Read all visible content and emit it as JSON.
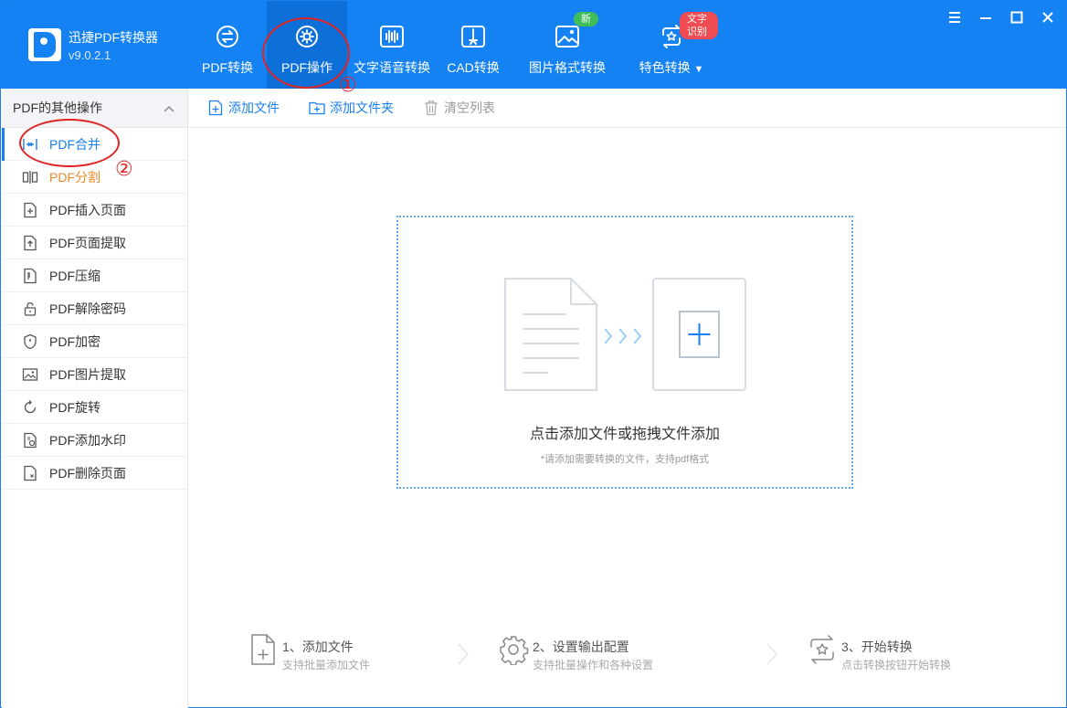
{
  "app": {
    "name": "迅捷PDF转换器",
    "version": "v9.0.2.1"
  },
  "nav": [
    {
      "label": "PDF转换",
      "icon": "pdf-convert-icon",
      "active": false
    },
    {
      "label": "PDF操作",
      "icon": "gear-icon",
      "active": true
    },
    {
      "label": "文字语音转换",
      "icon": "voice-wave-icon",
      "active": false
    },
    {
      "label": "CAD转换",
      "icon": "cad-icon",
      "active": false
    },
    {
      "label": "图片格式转换",
      "icon": "image-icon",
      "active": false,
      "badge": "新"
    },
    {
      "label": "特色转换",
      "icon": "feature-convert-icon",
      "active": false,
      "badge": "文字识别",
      "dropdown": true
    }
  ],
  "annotations": {
    "one": "①",
    "two": "②"
  },
  "sidebar": {
    "header": "PDF的其他操作",
    "items": [
      {
        "label": "PDF合并",
        "icon": "merge-icon",
        "state": "active"
      },
      {
        "label": "PDF分割",
        "icon": "split-icon",
        "state": "hover"
      },
      {
        "label": "PDF插入页面",
        "icon": "insert-page-icon",
        "state": ""
      },
      {
        "label": "PDF页面提取",
        "icon": "extract-page-icon",
        "state": ""
      },
      {
        "label": "PDF压缩",
        "icon": "compress-icon",
        "state": ""
      },
      {
        "label": "PDF解除密码",
        "icon": "unlock-icon",
        "state": ""
      },
      {
        "label": "PDF加密",
        "icon": "shield-icon",
        "state": ""
      },
      {
        "label": "PDF图片提取",
        "icon": "image-extract-icon",
        "state": ""
      },
      {
        "label": "PDF旋转",
        "icon": "rotate-icon",
        "state": ""
      },
      {
        "label": "PDF添加水印",
        "icon": "watermark-icon",
        "state": ""
      },
      {
        "label": "PDF删除页面",
        "icon": "delete-page-icon",
        "state": ""
      }
    ]
  },
  "toolbar": {
    "add_file": "添加文件",
    "add_folder": "添加文件夹",
    "clear_list": "清空列表"
  },
  "dropzone": {
    "title": "点击添加文件或拖拽文件添加",
    "subtitle": "*请添加需要转换的文件，支持pdf格式"
  },
  "steps": [
    {
      "title": "1、添加文件",
      "subtitle": "支持批量添加文件"
    },
    {
      "title": "2、设置输出配置",
      "subtitle": "支持批量操作和各种设置"
    },
    {
      "title": "3、开始转换",
      "subtitle": "点击转换按钮开始转换"
    }
  ],
  "colors": {
    "header": "#1482f2",
    "accent": "#1a7ff0",
    "annotation": "#e02424",
    "badge_new": "#3fbd59",
    "badge_ocr": "#ef4c54"
  }
}
